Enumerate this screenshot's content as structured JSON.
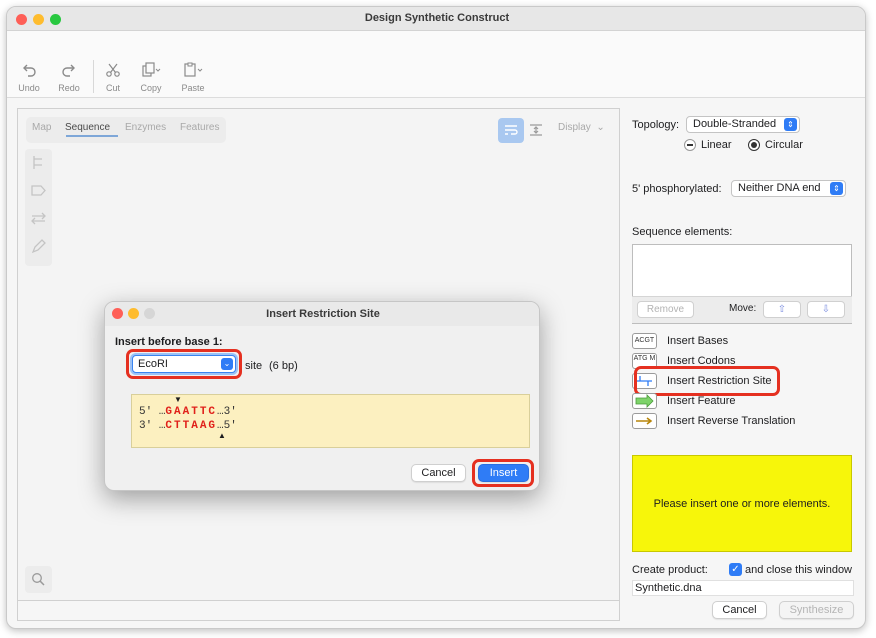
{
  "window": {
    "title": "Design Synthetic Construct"
  },
  "toolbar": {
    "undo": "Undo",
    "redo": "Redo",
    "cut": "Cut",
    "copy": "Copy",
    "paste": "Paste"
  },
  "tabs": [
    "Map",
    "Sequence",
    "Enzymes",
    "Features"
  ],
  "display_menu": "Display",
  "right": {
    "topology_label": "Topology:",
    "topology_value": "Double-Stranded",
    "linear": "Linear",
    "circular": "Circular",
    "phos_label": "5' phosphorylated:",
    "phos_value": "Neither DNA end",
    "seq_elements_label": "Sequence elements:",
    "remove": "Remove",
    "move": "Move:",
    "elements": [
      {
        "icon": "ACGT",
        "label": "Insert Bases"
      },
      {
        "icon": "ATG M",
        "label": "Insert Codons"
      },
      {
        "icon": "restriction-site-icon",
        "label": "Insert Restriction Site"
      },
      {
        "icon": "feature-arrow-icon",
        "label": "Insert Feature"
      },
      {
        "icon": "reverse-translation-icon",
        "label": "Insert Reverse Translation"
      }
    ],
    "hint": "Please insert one or more elements.",
    "create_product": "Create product:",
    "close_window": "and close this window",
    "filename": "Synthetic.dna",
    "cancel": "Cancel",
    "synthesize": "Synthesize"
  },
  "dialog": {
    "title": "Insert Restriction Site",
    "insert_before": "Insert before base 1:",
    "enzyme": "EcoRI",
    "site": "site",
    "size": "(6 bp)",
    "top_prefix": "5'",
    "top_dots": "…",
    "top_seq": "GAATTC",
    "top_suffix": "…3'",
    "bottom_prefix": "3'",
    "bottom_dots": "…",
    "bottom_seq": "CTTAAG",
    "bottom_suffix": "…5'",
    "cancel": "Cancel",
    "insert": "Insert"
  },
  "colors": {
    "accent": "#2f7cf6",
    "highlight": "#e53020",
    "hint_bg": "#f7f60a",
    "seq_bg": "#fcf0c0"
  }
}
